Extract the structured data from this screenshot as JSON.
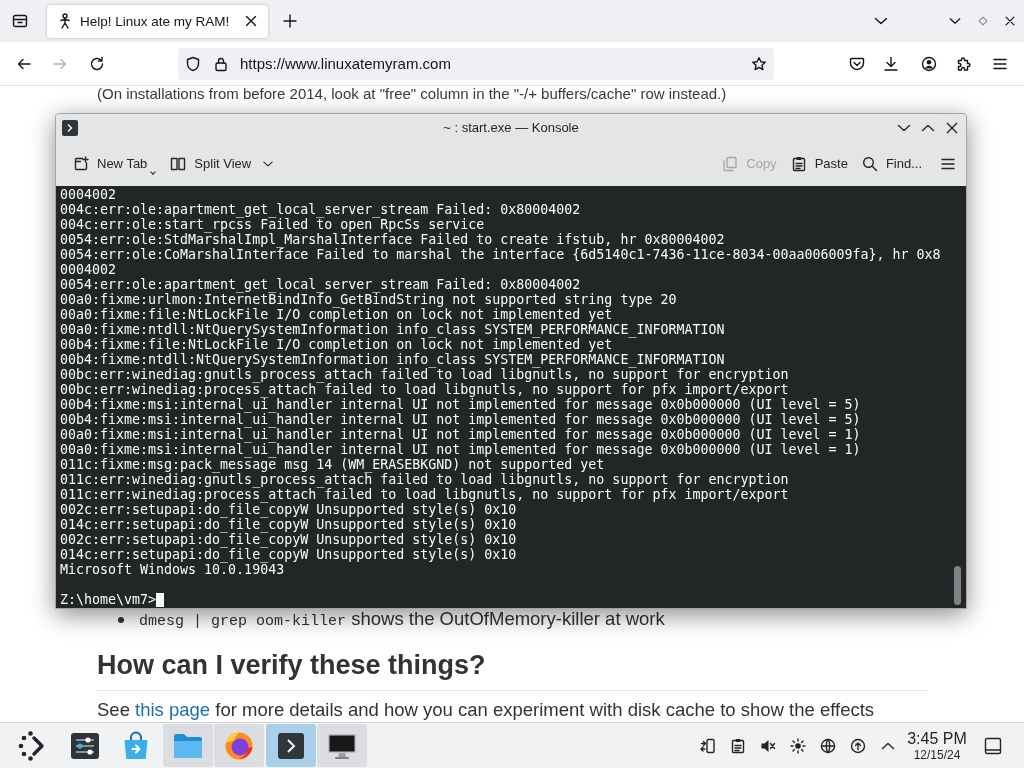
{
  "browser": {
    "tabs": [
      {
        "title": "Help! Linux ate my RAM!",
        "selected": true
      }
    ],
    "nav_buttons": [
      {
        "kind": "back",
        "disabled": false
      },
      {
        "kind": "forward",
        "disabled": true
      },
      {
        "kind": "reload",
        "disabled": false
      }
    ],
    "url": "https://www.linuxatemyram.com"
  },
  "page": {
    "note": "(On installations from before 2014, look at \"free\" column in the \"-/+ buffers/cache\" row instead.)",
    "list_item": {
      "code": "dmesg | grep oom-killer",
      "text": "shows the OutOfMemory-killer at work"
    },
    "heading": "How can I verify these things?",
    "paragraph": {
      "before": "See ",
      "link": "this page",
      "after": " for more details and how you can experiment with disk cache to show the effects"
    }
  },
  "konsole": {
    "title": "~ : start.exe — Konsole",
    "toolbar": {
      "left": [
        {
          "kind": "new-tab",
          "label": "New Tab",
          "disabled": false
        },
        {
          "kind": "split-view",
          "label": "Split View",
          "disabled": false
        }
      ],
      "right": [
        {
          "kind": "copy",
          "label": "Copy",
          "disabled": true
        },
        {
          "kind": "paste",
          "label": "Paste",
          "disabled": false
        },
        {
          "kind": "find",
          "label": "Find...",
          "disabled": false
        }
      ]
    },
    "lines": [
      "0004002",
      "004c:err:ole:apartment_get_local_server_stream Failed: 0x80004002",
      "004c:err:ole:start_rpcss Failed to open RpcSs service",
      "0054:err:ole:StdMarshalImpl_MarshalInterface Failed to create ifstub, hr 0x80004002",
      "0054:err:ole:CoMarshalInterface Failed to marshal the interface {6d5140c1-7436-11ce-8034-00aa006009fa}, hr 0x8",
      "0004002",
      "0054:err:ole:apartment_get_local_server_stream Failed: 0x80004002",
      "00a0:fixme:urlmon:InternetBindInfo_GetBindString not supported string type 20",
      "00a0:fixme:file:NtLockFile I/O completion on lock not implemented yet",
      "00a0:fixme:ntdll:NtQuerySystemInformation info_class SYSTEM_PERFORMANCE_INFORMATION",
      "00b4:fixme:file:NtLockFile I/O completion on lock not implemented yet",
      "00b4:fixme:ntdll:NtQuerySystemInformation info_class SYSTEM_PERFORMANCE_INFORMATION",
      "00bc:err:winediag:gnutls_process_attach failed to load libgnutls, no support for encryption",
      "00bc:err:winediag:process_attach failed to load libgnutls, no support for pfx import/export",
      "00b4:fixme:msi:internal_ui_handler internal UI not implemented for message 0x0b000000 (UI level = 5)",
      "00b4:fixme:msi:internal_ui_handler internal UI not implemented for message 0x0b000000 (UI level = 5)",
      "00a0:fixme:msi:internal_ui_handler internal UI not implemented for message 0x0b000000 (UI level = 1)",
      "00a0:fixme:msi:internal_ui_handler internal UI not implemented for message 0x0b000000 (UI level = 1)",
      "011c:fixme:msg:pack_message msg 14 (WM_ERASEBKGND) not supported yet",
      "011c:err:winediag:gnutls_process_attach failed to load libgnutls, no support for encryption",
      "011c:err:winediag:process_attach failed to load libgnutls, no support for pfx import/export",
      "002c:err:setupapi:do_file_copyW Unsupported style(s) 0x10",
      "014c:err:setupapi:do_file_copyW Unsupported style(s) 0x10",
      "002c:err:setupapi:do_file_copyW Unsupported style(s) 0x10",
      "014c:err:setupapi:do_file_copyW Unsupported style(s) 0x10",
      "Microsoft Windows 10.0.19043"
    ],
    "prompt": "Z:\\home\\vm7>"
  },
  "taskbar": {
    "tasks": [
      {
        "kind": "launcher",
        "running": false,
        "selected": false
      },
      {
        "kind": "settings",
        "running": false,
        "selected": false
      },
      {
        "kind": "store",
        "running": false,
        "selected": false
      },
      {
        "kind": "files",
        "running": true,
        "selected": false
      },
      {
        "kind": "browser",
        "running": true,
        "selected": false
      },
      {
        "kind": "terminal",
        "running": true,
        "selected": true
      },
      {
        "kind": "monitor",
        "running": true,
        "selected": false
      }
    ],
    "volume": {
      "muted": true
    },
    "clock": {
      "time": "3:45 PM",
      "date": "12/15/24"
    }
  }
}
